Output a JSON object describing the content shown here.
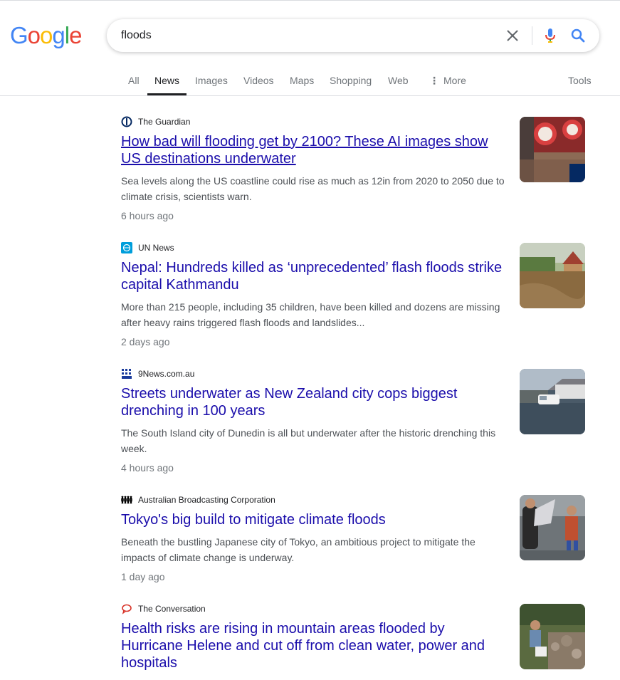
{
  "logo": {
    "text": "Google"
  },
  "search": {
    "query": "floods"
  },
  "tabs": [
    {
      "label": "All"
    },
    {
      "label": "News"
    },
    {
      "label": "Images"
    },
    {
      "label": "Videos"
    },
    {
      "label": "Maps"
    },
    {
      "label": "Shopping"
    },
    {
      "label": "Web"
    },
    {
      "label": "More"
    }
  ],
  "tools_label": "Tools",
  "results": [
    {
      "source": "The Guardian",
      "headline": "How bad will flooding get by 2100? These AI images show US destinations underwater",
      "snippet": "Sea levels along the US coastline could rise as much as 12in from 2020 to 2050 due to climate crisis, scientists warn.",
      "time": "6 hours ago"
    },
    {
      "source": "UN News",
      "headline": "Nepal: Hundreds killed as ‘unprecedented’ flash floods strike capital Kathmandu",
      "snippet": "More than 215 people, including 35 children, have been killed and dozens are missing after heavy rains triggered flash floods and landslides...",
      "time": "2 days ago"
    },
    {
      "source": "9News.com.au",
      "headline": "Streets underwater as New Zealand city cops biggest drenching in 100 years",
      "snippet": "The South Island city of Dunedin is all but underwater after the historic drenching this week.",
      "time": "4 hours ago"
    },
    {
      "source": "Australian Broadcasting Corporation",
      "headline": "Tokyo's big build to mitigate climate floods",
      "snippet": "Beneath the bustling Japanese city of Tokyo, an ambitious project to mitigate the impacts of climate change is underway.",
      "time": "1 day ago"
    },
    {
      "source": "The Conversation",
      "headline": "Health risks are rising in mountain areas flooded by Hurricane Helene and cut off from clean water, power and hospitals",
      "snippet": "",
      "time": ""
    }
  ],
  "colors": {
    "link": "#1a0dab",
    "google_blue": "#4285F4",
    "google_red": "#EA4335",
    "google_yellow": "#FBBC05",
    "google_green": "#34A853"
  }
}
